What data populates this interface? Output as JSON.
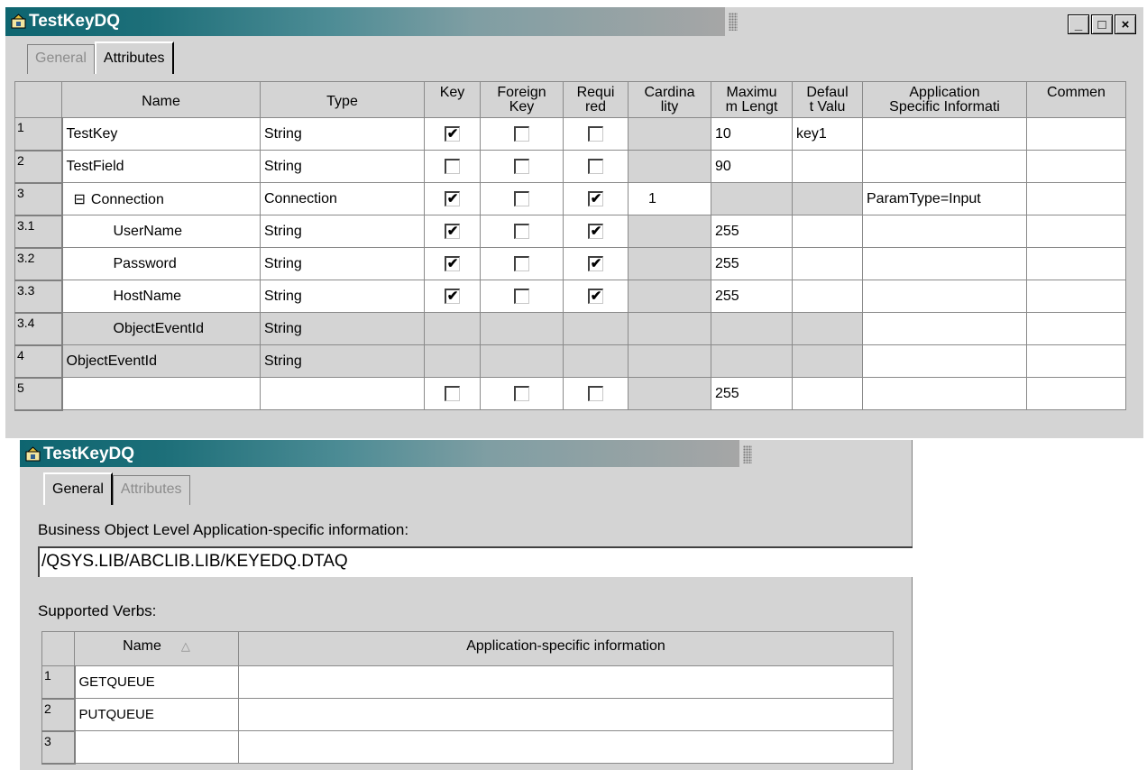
{
  "window1": {
    "title": "TestKeyDQ",
    "tabs": [
      "General",
      "Attributes"
    ],
    "active_tab": "Attributes",
    "controls": {
      "minimize": "_",
      "maximize": "□",
      "close": "×"
    },
    "columns": [
      "Name",
      "Type",
      "Key",
      "Foreign Key",
      "Required",
      "Cardinality",
      "Maximum Length",
      "Default Value",
      "Application Specific Information",
      "Comment"
    ],
    "column_headers_visible": [
      "Name",
      "Type",
      "Key",
      "Foreign\nKey",
      "Requi\nred",
      "Cardina\nlity",
      "Maximu\nm Lengt",
      "Defaul\nt Valu",
      "Application\nSpecific Informati",
      "Commen"
    ],
    "rows": [
      {
        "num": "1",
        "name": "TestKey",
        "indent": 0,
        "type": "String",
        "key": true,
        "foreign_key": false,
        "required": false,
        "cardinality": "",
        "max_length": "10",
        "default": "key1",
        "app_info": "",
        "disabled": false
      },
      {
        "num": "2",
        "name": "TestField",
        "indent": 0,
        "type": "String",
        "key": false,
        "foreign_key": false,
        "required": false,
        "cardinality": "",
        "max_length": "90",
        "default": "",
        "app_info": "",
        "disabled": false
      },
      {
        "num": "3",
        "name": "Connection",
        "indent": 0,
        "expander": "⊟",
        "type": "Connection",
        "key": true,
        "foreign_key": false,
        "required": true,
        "cardinality": "1",
        "max_length": "",
        "default": "",
        "app_info": "ParamType=Input",
        "disabled": false,
        "is_object": true
      },
      {
        "num": "3.1",
        "name": "UserName",
        "indent": 1,
        "type": "String",
        "key": true,
        "foreign_key": false,
        "required": true,
        "cardinality": "",
        "max_length": "255",
        "default": "",
        "app_info": "",
        "disabled": false
      },
      {
        "num": "3.2",
        "name": "Password",
        "indent": 1,
        "type": "String",
        "key": true,
        "foreign_key": false,
        "required": true,
        "cardinality": "",
        "max_length": "255",
        "default": "",
        "app_info": "",
        "disabled": false
      },
      {
        "num": "3.3",
        "name": "HostName",
        "indent": 1,
        "type": "String",
        "key": true,
        "foreign_key": false,
        "required": true,
        "cardinality": "",
        "max_length": "255",
        "default": "",
        "app_info": "",
        "disabled": false
      },
      {
        "num": "3.4",
        "name": "ObjectEventId",
        "indent": 1,
        "type": "String",
        "disabled": true
      },
      {
        "num": "4",
        "name": "ObjectEventId",
        "indent": 0,
        "type": "String",
        "disabled": true
      },
      {
        "num": "5",
        "name": "",
        "indent": 0,
        "type": "",
        "key": false,
        "foreign_key": false,
        "required": false,
        "cardinality": "",
        "max_length": "255",
        "default": "",
        "app_info": "",
        "disabled": false
      }
    ]
  },
  "window2": {
    "title": "TestKeyDQ",
    "tabs": [
      "General",
      "Attributes"
    ],
    "active_tab": "General",
    "bo_label": "Business Object Level Application-specific information:",
    "bo_value": "/QSYS.LIB/ABCLIB.LIB/KEYEDQ.DTAQ",
    "verbs_label": "Supported Verbs:",
    "verbs_columns": [
      "Name",
      "Application-specific information"
    ],
    "verbs": [
      {
        "num": "1",
        "name": "GETQUEUE",
        "info": ""
      },
      {
        "num": "2",
        "name": "PUTQUEUE",
        "info": ""
      },
      {
        "num": "3",
        "name": "",
        "info": ""
      }
    ]
  },
  "colors": {
    "title_start": "#0e6570",
    "title_end": "#a6a6a6",
    "disabled_cell": "#d4d4d4",
    "cell": "#ffffff"
  }
}
